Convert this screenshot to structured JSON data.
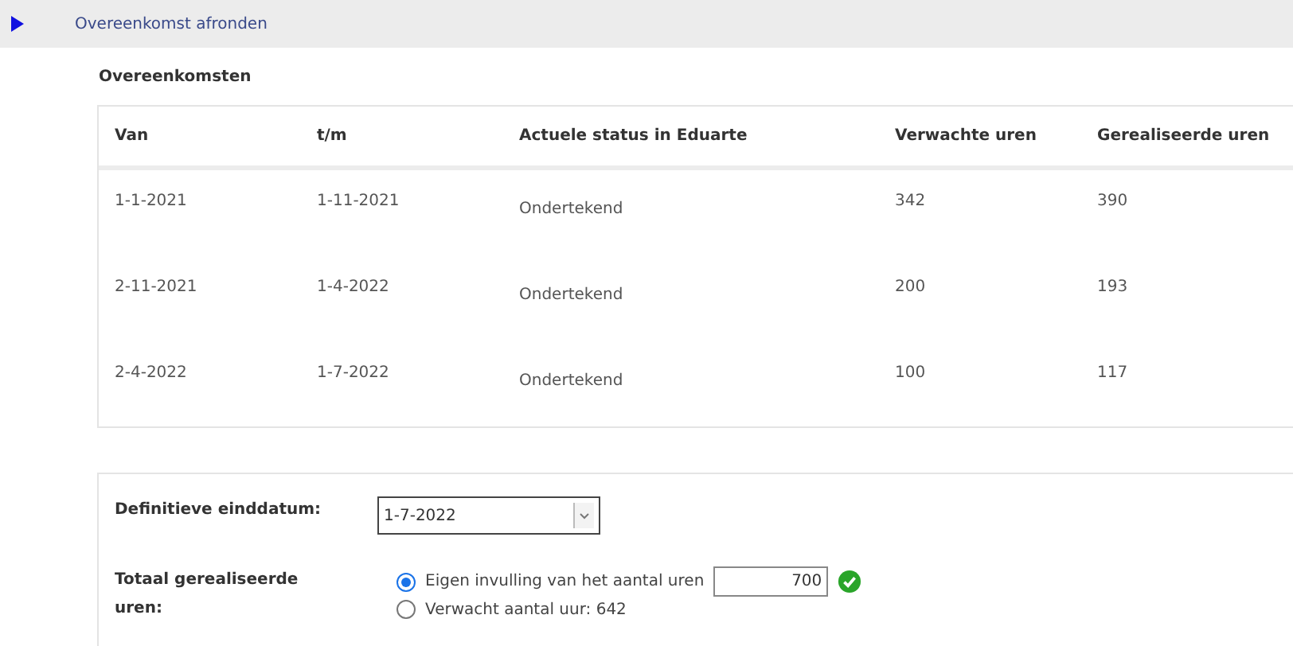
{
  "section": {
    "title": "Overeenkomst afronden",
    "expanded": true
  },
  "agreements": {
    "title": "Overeenkomsten",
    "columns": [
      "Van",
      "t/m",
      "Actuele status in Eduarte",
      "Verwachte uren",
      "Gerealiseerde uren"
    ],
    "rows": [
      {
        "cells": [
          "1-1-2021",
          "1-11-2021",
          "Ondertekend",
          "342",
          "390"
        ]
      },
      {
        "cells": [
          "2-11-2021",
          "1-4-2022",
          "Ondertekend",
          "200",
          "193"
        ]
      },
      {
        "cells": [
          "2-4-2022",
          "1-7-2022",
          "Ondertekend",
          "100",
          "117"
        ]
      }
    ]
  },
  "form": {
    "end_date": {
      "label": "Definitieve einddatum:",
      "value": "1-7-2022"
    },
    "total_hours": {
      "label": "Totaal gerealiseerde uren:",
      "options": [
        {
          "label": "Eigen invulling van het aantal uren",
          "selected": true,
          "value": "700",
          "valid": true
        },
        {
          "label": "Verwacht aantal uur: 642",
          "selected": false
        }
      ]
    }
  }
}
